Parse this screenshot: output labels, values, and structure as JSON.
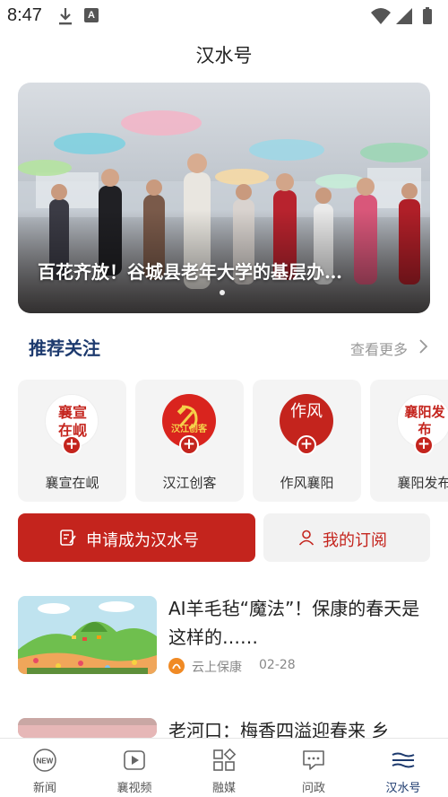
{
  "status_bar": {
    "time": "8:47",
    "notification_icons": [
      "download-icon",
      "a-badge-icon"
    ],
    "system_icons": [
      "wifi-icon",
      "signal-icon",
      "battery-icon"
    ]
  },
  "header": {
    "title": "汉水号"
  },
  "banner": {
    "caption": "百花齐放！谷城县老年大学的基层办…",
    "slide_count": 1,
    "active_slide": 1
  },
  "recommend": {
    "title": "推荐关注",
    "see_more": "查看更多",
    "accounts": [
      {
        "name": "襄宣在岘",
        "avatar_text": "襄宣在岘",
        "follow_icon": "plus-icon"
      },
      {
        "name": "汉江创客",
        "avatar_text": "汉江创客",
        "follow_icon": "plus-icon"
      },
      {
        "name": "作风襄阳",
        "avatar_text": "作风",
        "follow_icon": "plus-icon"
      },
      {
        "name": "襄阳发布",
        "avatar_text": "襄阳发布",
        "follow_icon": "plus-icon"
      }
    ]
  },
  "actions": {
    "apply_label": "申请成为汉水号",
    "subscribe_label": "我的订阅"
  },
  "news": [
    {
      "title": "AI羊毛毡“魔法”！保康的春天是这样的……",
      "source": "云上保康",
      "date": "02-28"
    },
    {
      "title": "老河口：梅香四溢迎春来 乡",
      "source": "",
      "date": ""
    }
  ],
  "tabs": [
    {
      "label": "新闻",
      "icon": "news-icon",
      "active": false
    },
    {
      "label": "襄视频",
      "icon": "video-icon",
      "active": false
    },
    {
      "label": "融媒",
      "icon": "media-icon",
      "active": false
    },
    {
      "label": "问政",
      "icon": "chat-icon",
      "active": false
    },
    {
      "label": "汉水号",
      "icon": "hanshui-icon",
      "active": true
    }
  ],
  "colors": {
    "brand_red": "#c4241d",
    "title_blue": "#1d3a6e",
    "card_bg": "#f4f4f4"
  }
}
